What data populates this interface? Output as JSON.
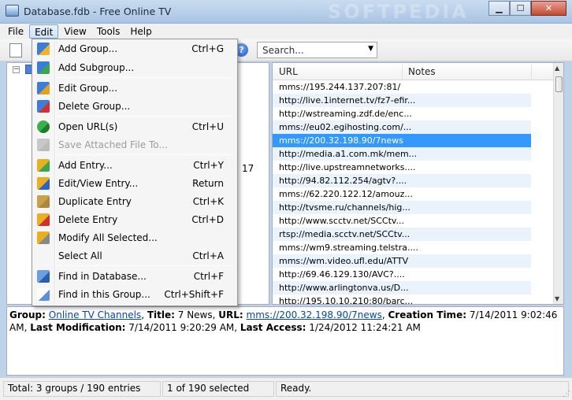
{
  "window": {
    "title": "Database.fdb - Free Online TV",
    "watermark": "SOFTPEDIA",
    "min_glyph": "▁",
    "max_glyph": "☐",
    "close_glyph": "✕"
  },
  "menubar": {
    "items": [
      {
        "label": "File"
      },
      {
        "label": "Edit"
      },
      {
        "label": "View"
      },
      {
        "label": "Tools"
      },
      {
        "label": "Help"
      }
    ]
  },
  "toolbar": {
    "help_glyph": "?",
    "search_text": "Search...",
    "search_arrow": "▼"
  },
  "tree": {
    "expander_glyph": "−"
  },
  "grid": {
    "headers": {
      "url": "URL",
      "notes": "Notes"
    },
    "stray_text": "17",
    "rows": [
      {
        "url": "mms://195.244.137.207:81/"
      },
      {
        "url": "http://live.1internet.tv/fz7-efir..."
      },
      {
        "url": "http://wstreaming.zdf.de/enc..."
      },
      {
        "url": "mms://eu02.egihosting.com/..."
      },
      {
        "url": "mms://200.32.198.90/7news"
      },
      {
        "url": "http://media.a1.com.mk/mem..."
      },
      {
        "url": "http://live.upstreamnetworks...."
      },
      {
        "url": "http://94.82.112.254/agtv?...."
      },
      {
        "url": "mms://62.220.122.12/amouz..."
      },
      {
        "url": "http://tvsme.ru/channels/hig..."
      },
      {
        "url": "http://www.scctv.net/SCCtv..."
      },
      {
        "url": "rtsp://media.scctv.net/SCCtv..."
      },
      {
        "url": "mms://wm9.streaming.telstra...."
      },
      {
        "url": "mms://wm.video.ufl.edu/ATTV"
      },
      {
        "url": "http://69.46.129.130/AVC?...."
      },
      {
        "url": "http://www.arlingtonva.us/D..."
      },
      {
        "url": "http://195.10.10.210:80/barc..."
      }
    ],
    "selected_index": 4,
    "scroll_up": "▲",
    "scroll_down": "▼"
  },
  "details": {
    "group_label": "Group:",
    "group_value": "Online TV Channels",
    "title_label": "Title:",
    "title_value": "7 News,",
    "url_label": "URL:",
    "url_value": "mms://200.32.198.90/7news",
    "creation_label": "Creation Time:",
    "creation_value": "7/14/2011 9:02:46 AM,",
    "lastmod_label": "Last Modification:",
    "lastmod_value": "7/14/2011 9:20:29 AM,",
    "lastaccess_label": "Last Access:",
    "lastaccess_value": "1/24/2012 11:24:21 AM"
  },
  "statusbar": {
    "total": "Total: 3 groups / 190 entries",
    "selected": "1 of 190 selected",
    "status": "Ready.",
    "grip": "⋰"
  },
  "edit_menu": {
    "items": [
      {
        "icon": "add-group-icon",
        "label": "Add Group...",
        "shortcut": "Ctrl+G"
      },
      {
        "icon": "add-subgroup-icon",
        "label": "Add Subgroup...",
        "shortcut": ""
      },
      {
        "icon": "edit-group-icon",
        "label": "Edit Group...",
        "shortcut": ""
      },
      {
        "icon": "delete-group-icon",
        "label": "Delete Group...",
        "shortcut": ""
      },
      {
        "icon": "open-url-icon",
        "label": "Open URL(s)",
        "shortcut": "Ctrl+U"
      },
      {
        "icon": "save-attached-icon",
        "label": "Save Attached File To...",
        "shortcut": ""
      },
      {
        "icon": "add-entry-icon",
        "label": "Add Entry...",
        "shortcut": "Ctrl+Y"
      },
      {
        "icon": "edit-entry-icon",
        "label": "Edit/View Entry...",
        "shortcut": "Return"
      },
      {
        "icon": "duplicate-entry-icon",
        "label": "Duplicate Entry",
        "shortcut": "Ctrl+K"
      },
      {
        "icon": "delete-entry-icon",
        "label": "Delete Entry",
        "shortcut": "Ctrl+D"
      },
      {
        "icon": "modify-selected-icon",
        "label": "Modify All Selected...",
        "shortcut": ""
      },
      {
        "icon": "",
        "label": "Select All",
        "shortcut": "Ctrl+A"
      },
      {
        "icon": "find-database-icon",
        "label": "Find in Database...",
        "shortcut": "Ctrl+F"
      },
      {
        "icon": "find-group-icon",
        "label": "Find in this Group...",
        "shortcut": "Ctrl+Shift+F"
      }
    ]
  }
}
